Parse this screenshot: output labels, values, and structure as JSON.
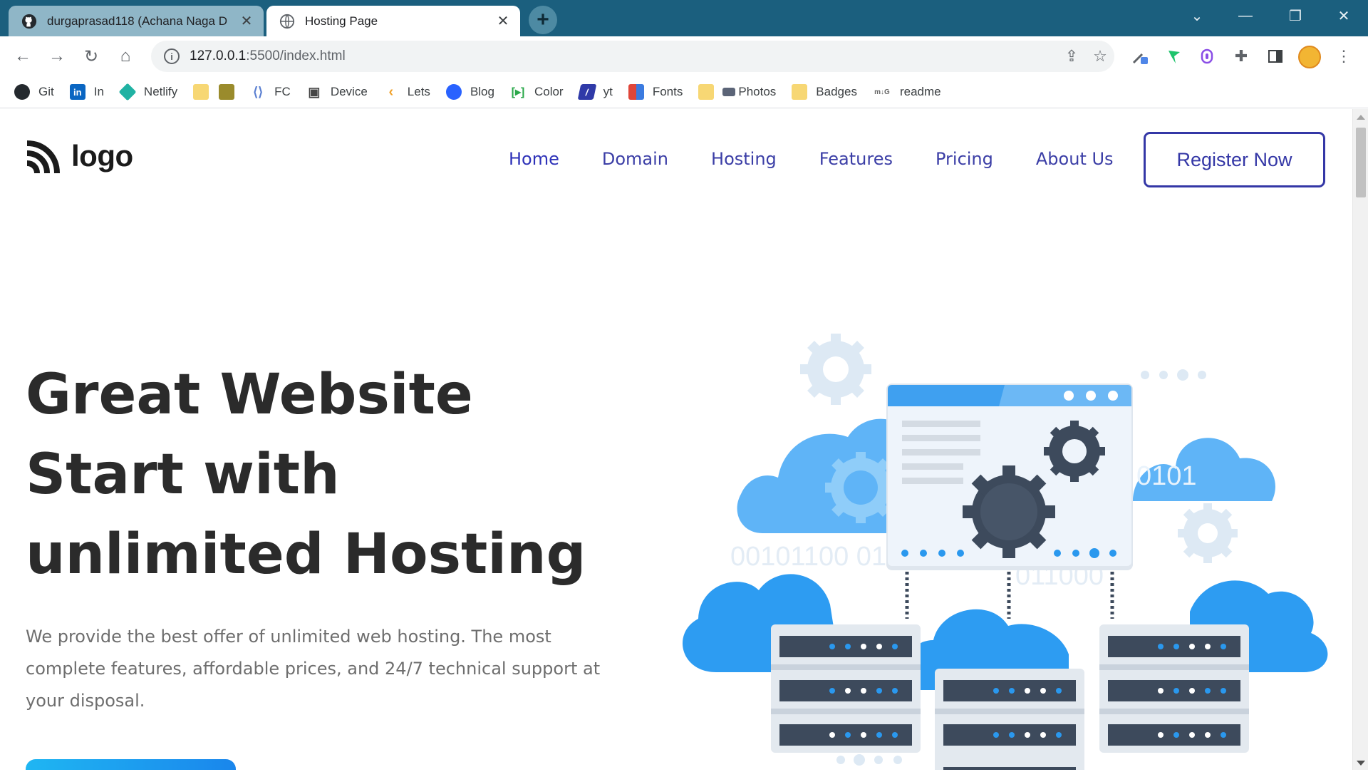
{
  "browser": {
    "tabs": [
      {
        "title": "durgaprasad118 (Achana Naga D",
        "icon": "github-icon"
      },
      {
        "title": "Hosting Page",
        "icon": "globe-icon"
      }
    ],
    "address": {
      "host": "127.0.0.1",
      "rest": ":5500/index.html"
    },
    "bookmarks": [
      {
        "label": "Git",
        "icon": "github-icon",
        "color": "#24292e"
      },
      {
        "label": "In",
        "icon": "linkedin-icon",
        "color": "#0a66c2"
      },
      {
        "label": "Netlify",
        "icon": "netlify-icon",
        "color": "#20b2a3"
      },
      {
        "label": "",
        "icon": "folder-icon",
        "color": "#f7d774"
      },
      {
        "label": "",
        "icon": "trophy-icon",
        "color": "#9a8b2c"
      },
      {
        "label": "FC",
        "icon": "code-icon",
        "color": "#5a7fd1"
      },
      {
        "label": "Device",
        "icon": "devices-icon",
        "color": "#444444"
      },
      {
        "label": "Lets",
        "icon": "leetcode-icon",
        "color": "#f0a028"
      },
      {
        "label": "Blog",
        "icon": "hashnode-icon",
        "color": "#2962ff"
      },
      {
        "label": "Color",
        "icon": "color-icon",
        "color": "#2aa84a"
      },
      {
        "label": "yt",
        "icon": "youtube-icon",
        "color": "#2f3aa8"
      },
      {
        "label": "Fonts",
        "icon": "fonts-icon",
        "color": "#e0463a"
      },
      {
        "label": "Photos",
        "icon": "photos-icon",
        "color": "#f7d774"
      },
      {
        "label": "Badges",
        "icon": "folder-icon",
        "color": "#f7d774"
      },
      {
        "label": "readme",
        "icon": "readme-icon",
        "color": "#666666"
      }
    ]
  },
  "page": {
    "logo_text": "logo",
    "nav": [
      "Home",
      "Domain",
      "Hosting",
      "Features",
      "Pricing",
      "About Us"
    ],
    "register_label": "Register Now",
    "hero": {
      "title": "Great Website Start with unlimited Hosting",
      "description": "We provide the best offer of unlimited web hosting. The most complete features, affordable prices, and 24/7 technical support at your disposal."
    },
    "illustration": {
      "binary_texts": [
        "0101",
        "00101100 0101",
        "011000"
      ],
      "colors": {
        "cloud": "#42a5f5",
        "cloud_light": "#b9dcf7",
        "server": "#3d4a5c",
        "window": "#eef4fb",
        "gear": "#3d4a5c"
      }
    }
  }
}
